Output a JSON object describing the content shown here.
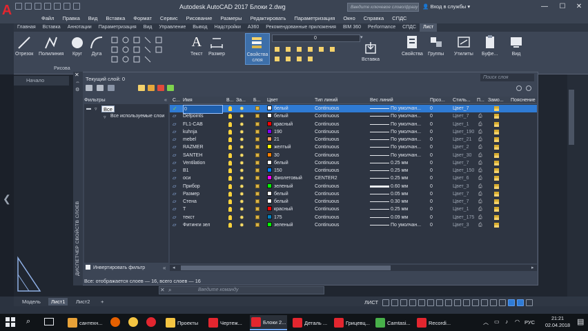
{
  "window": {
    "title": "Autodesk AutoCAD 2017   Блоки 2.dwg",
    "search_placeholder": "Введите ключевое слово/фразу",
    "signin": "Вход в службы",
    "controls": [
      "—",
      "☐",
      "✕"
    ]
  },
  "menubar": [
    "Файл",
    "Правка",
    "Вид",
    "Вставка",
    "Формат",
    "Сервис",
    "Рисование",
    "Размеры",
    "Редактировать",
    "Параметризация",
    "Окно",
    "Справка",
    "СПДС"
  ],
  "ribbon_tabs": [
    "Главная",
    "Вставка",
    "Аннотации",
    "Параметризация",
    "Вид",
    "Управление",
    "Вывод",
    "Надстройки",
    "A360",
    "Рекомендованные приложения",
    "BIM 360",
    "Performance",
    "СПДС",
    "Лист"
  ],
  "ribbon_active_tab": "Лист",
  "ribbon": {
    "tools": [
      "Отрезок",
      "Полилиния",
      "Круг",
      "Дуга",
      "Текст",
      "Размер",
      "Свойства слоя",
      "Вставка",
      "Свойства",
      "Группы",
      "Утилиты",
      "Буфе...",
      "Вид"
    ],
    "layer_dropdown": "0",
    "panel_label": "Рисова"
  },
  "drawing_tab": "Начало",
  "layer_manager": {
    "side_title": "ДИСПЕТЧЕР СВОЙСТВ СЛОЕВ",
    "current_layer": "Текущий слой: 0",
    "search_placeholder": "Поиск слоя",
    "filters_header": "Фильтры",
    "tree_all": "Все",
    "tree_used": "Все используемые слои",
    "invert_filter": "Инвертировать фильтр",
    "status": "Все: отображается слоев — 16, всего слоев — 16",
    "columns": [
      "С...",
      "Имя",
      "В...",
      "За...",
      "Б...",
      "Цвет",
      "Тип линий",
      "Вес линий",
      "Проз...",
      "Стиль...",
      "П...",
      "Замо...",
      "Пояснение"
    ],
    "rows": [
      {
        "name": "0",
        "color_name": "белый",
        "color": "#ffffff",
        "linetype": "Continuous",
        "weight": "По умолчан...",
        "transp": "0",
        "style": "Цвет_7",
        "current": true,
        "thick": false
      },
      {
        "name": "Defpoints",
        "color_name": "белый",
        "color": "#ffffff",
        "linetype": "Continuous",
        "weight": "По умолчан...",
        "transp": "0",
        "style": "Цвет_7",
        "current": false,
        "thick": false
      },
      {
        "name": "FL1-CAB",
        "color_name": "красный",
        "color": "#ff0000",
        "linetype": "Continuous",
        "weight": "По умолчан...",
        "transp": "0",
        "style": "Цвет_1",
        "current": false,
        "thick": false
      },
      {
        "name": "kuhnja",
        "color_name": "190",
        "color": "#8000ff",
        "linetype": "Continuous",
        "weight": "По умолчан...",
        "transp": "0",
        "style": "Цвет_190",
        "current": false,
        "thick": false
      },
      {
        "name": "mebel",
        "color_name": "21",
        "color": "#ff9d5c",
        "linetype": "Continuous",
        "weight": "По умолчан...",
        "transp": "0",
        "style": "Цвет_21",
        "current": false,
        "thick": false
      },
      {
        "name": "RAZMER",
        "color_name": "желтый",
        "color": "#ffff00",
        "linetype": "Continuous",
        "weight": "По умолчан...",
        "transp": "0",
        "style": "Цвет_2",
        "current": false,
        "thick": false
      },
      {
        "name": "SANTEH",
        "color_name": "30",
        "color": "#ff8000",
        "linetype": "Continuous",
        "weight": "По умолчан...",
        "transp": "0",
        "style": "Цвет_30",
        "current": false,
        "thick": false
      },
      {
        "name": "Ventilation",
        "color_name": "белый",
        "color": "#ffffff",
        "linetype": "Continuous",
        "weight": "0.25 мм",
        "transp": "0",
        "style": "Цвет_7",
        "current": false,
        "thick": false
      },
      {
        "name": "В1",
        "color_name": "150",
        "color": "#007fff",
        "linetype": "Continuous",
        "weight": "0.25 мм",
        "transp": "0",
        "style": "Цвет_150",
        "current": false,
        "thick": false
      },
      {
        "name": "оси",
        "color_name": "фиолетовый",
        "color": "#ff00ff",
        "linetype": "CENTER2",
        "weight": "0.25 мм",
        "transp": "0",
        "style": "Цвет_6",
        "current": false,
        "thick": false
      },
      {
        "name": "Прибор",
        "color_name": "зеленый",
        "color": "#00ff00",
        "linetype": "Continuous",
        "weight": "0.60 мм",
        "transp": "0",
        "style": "Цвет_3",
        "current": false,
        "thick": true
      },
      {
        "name": "Размер",
        "color_name": "белый",
        "color": "#ffffff",
        "linetype": "Continuous",
        "weight": "0.05 мм",
        "transp": "0",
        "style": "Цвет_7",
        "current": false,
        "thick": false
      },
      {
        "name": "Стена",
        "color_name": "белый",
        "color": "#ffffff",
        "linetype": "Continuous",
        "weight": "0.30 мм",
        "transp": "0",
        "style": "Цвет_7",
        "current": false,
        "thick": false
      },
      {
        "name": "Т",
        "color_name": "красный",
        "color": "#ff0000",
        "linetype": "Continuous",
        "weight": "0.25 мм",
        "transp": "0",
        "style": "Цвет_1",
        "current": false,
        "thick": false
      },
      {
        "name": "текст",
        "color_name": "175",
        "color": "#0080bf",
        "linetype": "Continuous",
        "weight": "0.09 мм",
        "transp": "0",
        "style": "Цвет_175",
        "current": false,
        "thick": false
      },
      {
        "name": "Фитинги зел",
        "color_name": "зеленый",
        "color": "#00ff00",
        "linetype": "Continuous",
        "weight": "По умолчан...",
        "transp": "0",
        "style": "Цвет_3",
        "current": false,
        "thick": false
      }
    ]
  },
  "command_placeholder": "Введите команду",
  "layout_tabs": [
    "Модель",
    "Лист1",
    "Лист2",
    "+"
  ],
  "layout_active": "Лист1",
  "statusbar_label": "ЛИСТ",
  "taskbar": {
    "items": [
      "сантехн...",
      "Проекты",
      "Чертеж...",
      "Блоки 2...",
      "Деталь ...",
      "Грицевц...",
      "Camtasi...",
      "Recordi..."
    ],
    "lang": "РУС",
    "time": "21:21",
    "date": "02.04.2018"
  },
  "colors": {
    "accent": "#2f7bd4",
    "brand": "#e3262f"
  }
}
